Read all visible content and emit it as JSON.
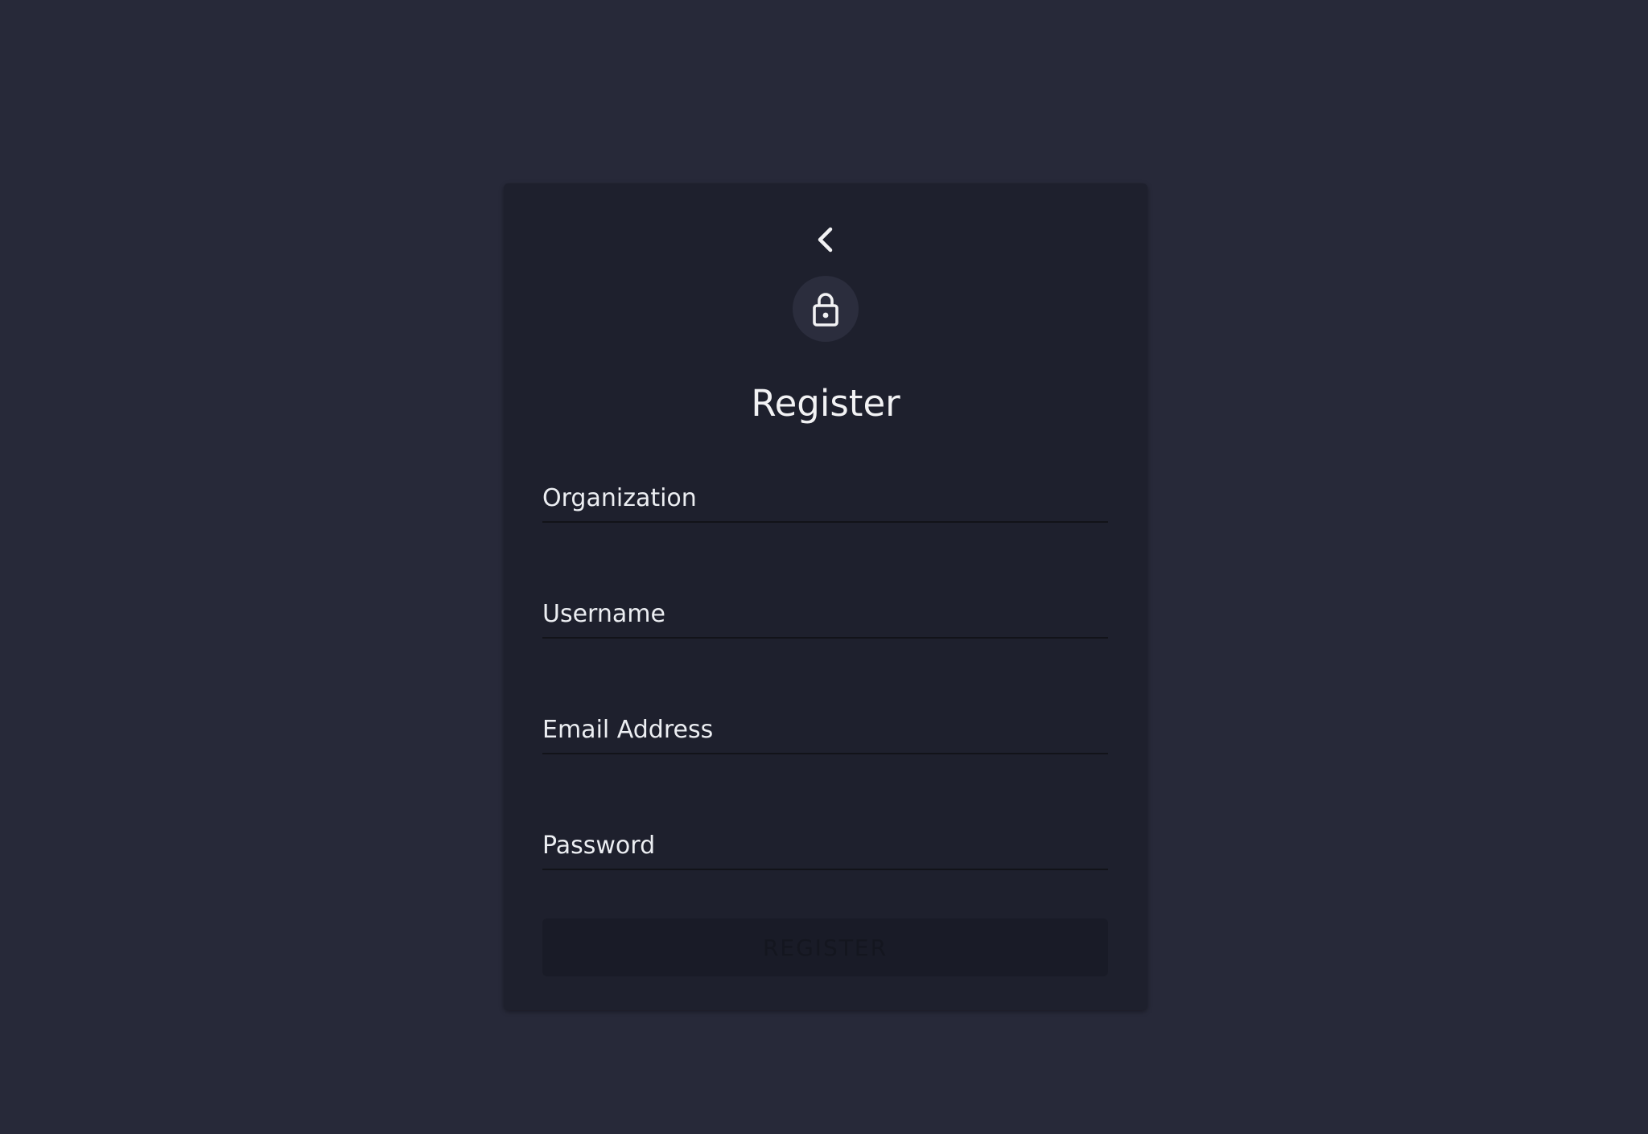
{
  "colors": {
    "page_background": "#272939",
    "card_background": "#1e202d",
    "avatar_background": "#2b2d3d",
    "text": "#f2f2f4",
    "button_disabled_background": "#191b27"
  },
  "header": {
    "back_icon": "chevron-left-icon",
    "avatar_icon": "lock-icon",
    "title": "Register"
  },
  "form": {
    "fields": [
      {
        "label": "Organization",
        "value": ""
      },
      {
        "label": "Username",
        "value": ""
      },
      {
        "label": "Email Address",
        "value": ""
      },
      {
        "label": "Password",
        "value": ""
      }
    ],
    "submit_label": "REGISTER",
    "submit_disabled": true
  }
}
